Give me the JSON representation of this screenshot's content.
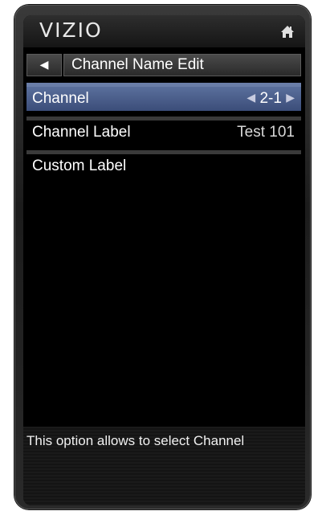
{
  "brand": {
    "logo_text": "VIZIO"
  },
  "header": {
    "title": "Channel Name Edit"
  },
  "menu": {
    "items": [
      {
        "label": "Channel",
        "value": "2-1",
        "selected": true
      },
      {
        "label": "Channel Label",
        "value": "Test 101",
        "selected": false
      },
      {
        "label": "Custom Label",
        "value": "",
        "selected": false
      }
    ]
  },
  "help": {
    "text": "This option allows to select Channel"
  },
  "colors": {
    "selected_bar": "#4a5f8e",
    "background": "#000000",
    "text": "#ffffff"
  }
}
